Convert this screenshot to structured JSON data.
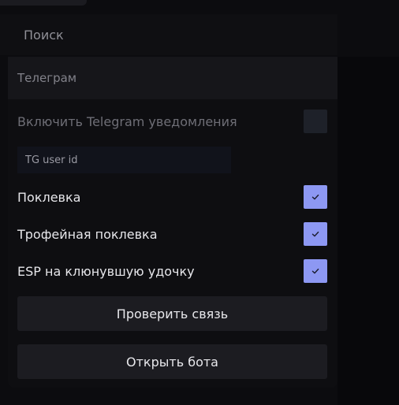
{
  "search": {
    "label": "Поиск"
  },
  "section": {
    "title": "Телеграм"
  },
  "telegram": {
    "enable_label": "Включить Telegram уведомления",
    "enable_checked": false,
    "user_id_placeholder": "TG user id",
    "user_id_value": ""
  },
  "options": [
    {
      "label": "Поклевка",
      "checked": true
    },
    {
      "label": "Трофейная поклевка",
      "checked": true
    },
    {
      "label": "ESP на клюнувшую удочку",
      "checked": true
    }
  ],
  "buttons": {
    "test_connection": "Проверить связь",
    "open_bot": "Открыть бота"
  },
  "colors": {
    "accent": "#8d98f3",
    "checkbox_off": "#1e2129",
    "button_bg": "#1c1c21"
  },
  "icons": {
    "checkmark": "check-icon"
  }
}
